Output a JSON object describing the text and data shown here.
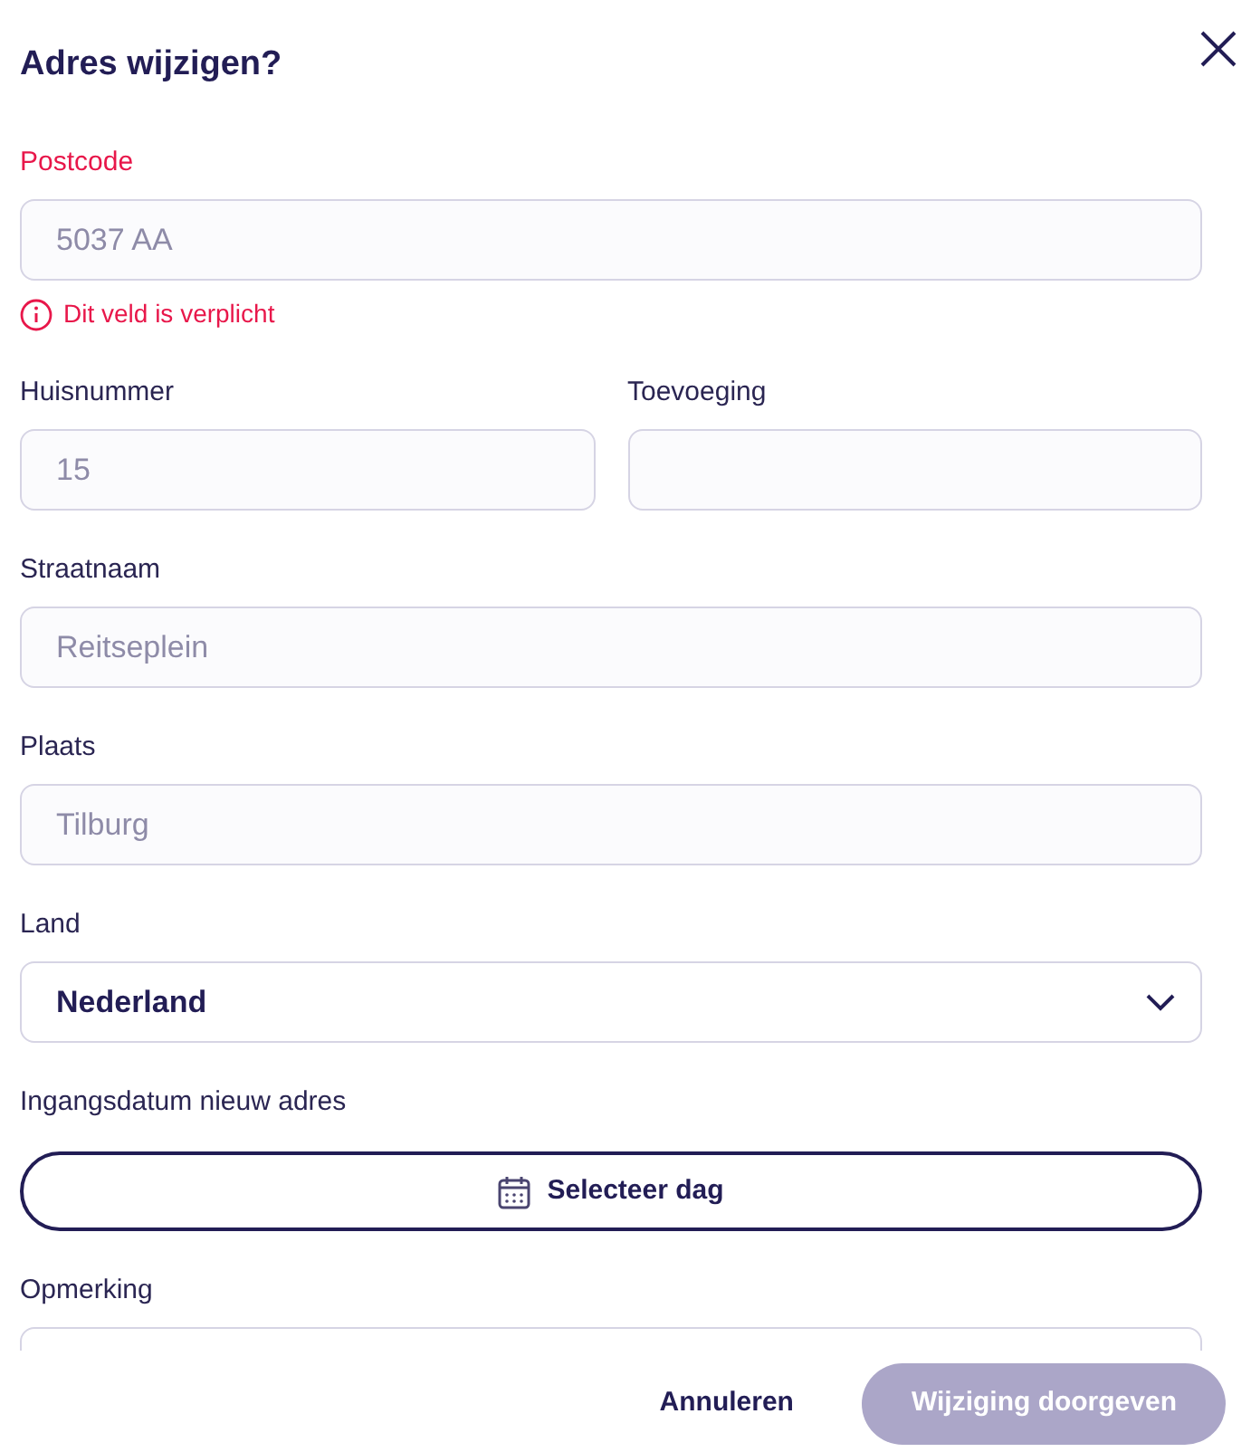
{
  "title": "Adres wijzigen?",
  "rows": [
    [
      {
        "kind": "text",
        "label": "Postcode",
        "value": "5037 AA",
        "disabled": true,
        "error": "Dit veld is verplicht"
      }
    ],
    [
      {
        "kind": "text",
        "label": "Huisnummer",
        "value": "15",
        "disabled": true
      },
      {
        "kind": "text",
        "label": "Toevoeging"
      }
    ],
    [
      {
        "kind": "text",
        "label": "Straatnaam",
        "value": "Reitseplein",
        "disabled": true
      }
    ],
    [
      {
        "kind": "text",
        "label": "Plaats",
        "value": "Tilburg",
        "disabled": true
      }
    ],
    [
      {
        "kind": "select",
        "label": "Land",
        "value": "Nederland"
      }
    ],
    [
      {
        "kind": "date",
        "label": "Ingangsdatum nieuw adres",
        "button": "Selecteer dag"
      }
    ],
    [
      {
        "kind": "textarea",
        "label": "Opmerking"
      }
    ]
  ],
  "buttons": [
    {
      "label": "Annuleren",
      "kind": "text",
      "disabled": false
    },
    {
      "label": "Wijziging doorgeven",
      "kind": "primary",
      "disabled": true
    }
  ]
}
